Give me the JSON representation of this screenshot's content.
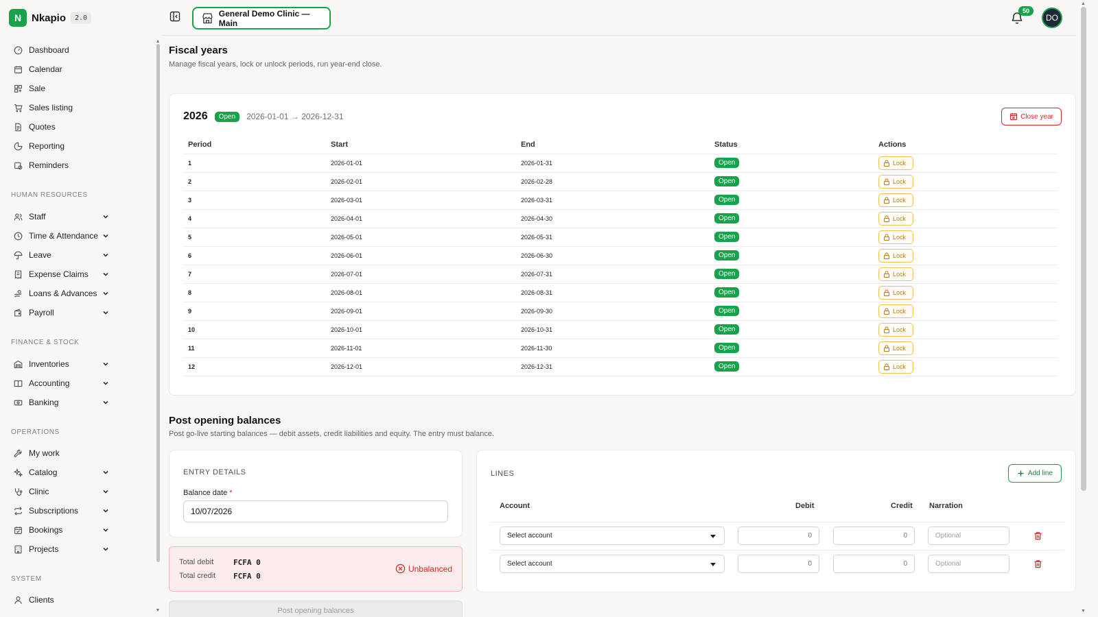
{
  "brand": {
    "initial": "N",
    "name": "Nkapio",
    "version": "2.0"
  },
  "nav": {
    "top": [
      "Dashboard",
      "Calendar",
      "Sale",
      "Sales listing",
      "Quotes",
      "Reporting",
      "Reminders"
    ],
    "hr_title": "HUMAN RESOURCES",
    "hr": [
      "Staff",
      "Time & Attendance",
      "Leave",
      "Expense Claims",
      "Loans & Advances",
      "Payroll"
    ],
    "fin_title": "FINANCE & STOCK",
    "fin": [
      "Inventories",
      "Accounting",
      "Banking"
    ],
    "ops_title": "OPERATIONS",
    "ops": [
      "My work",
      "Catalog",
      "Clinic",
      "Subscriptions",
      "Bookings",
      "Projects"
    ],
    "sys_title": "SYSTEM",
    "sys": [
      "Clients"
    ]
  },
  "topbar": {
    "clinic": "General Demo Clinic — Main",
    "notifications": "50",
    "avatar": "DO"
  },
  "fiscal": {
    "title": "Fiscal years",
    "subtitle": "Manage fiscal years, lock or unlock periods, run year-end close.",
    "year": "2026",
    "status": "Open",
    "range": "2026-01-01 → 2026-12-31",
    "close_btn": "Close year",
    "headers": [
      "Period",
      "Start",
      "End",
      "Status",
      "Actions"
    ],
    "lock_label": "Lock",
    "periods": [
      {
        "period": "1",
        "start": "2026-01-01",
        "end": "2026-01-31",
        "status": "Open"
      },
      {
        "period": "2",
        "start": "2026-02-01",
        "end": "2026-02-28",
        "status": "Open"
      },
      {
        "period": "3",
        "start": "2026-03-01",
        "end": "2026-03-31",
        "status": "Open"
      },
      {
        "period": "4",
        "start": "2026-04-01",
        "end": "2026-04-30",
        "status": "Open"
      },
      {
        "period": "5",
        "start": "2026-05-01",
        "end": "2026-05-31",
        "status": "Open"
      },
      {
        "period": "6",
        "start": "2026-06-01",
        "end": "2026-06-30",
        "status": "Open"
      },
      {
        "period": "7",
        "start": "2026-07-01",
        "end": "2026-07-31",
        "status": "Open"
      },
      {
        "period": "8",
        "start": "2026-08-01",
        "end": "2026-08-31",
        "status": "Open"
      },
      {
        "period": "9",
        "start": "2026-09-01",
        "end": "2026-09-30",
        "status": "Open"
      },
      {
        "period": "10",
        "start": "2026-10-01",
        "end": "2026-10-31",
        "status": "Open"
      },
      {
        "period": "11",
        "start": "2026-11-01",
        "end": "2026-11-30",
        "status": "Open"
      },
      {
        "period": "12",
        "start": "2026-12-01",
        "end": "2026-12-31",
        "status": "Open"
      }
    ]
  },
  "opening": {
    "title": "Post opening balances",
    "subtitle": "Post go-live starting balances — debit assets, credit liabilities and equity. The entry must balance.",
    "entry_title": "ENTRY DETAILS",
    "date_label": "Balance date",
    "date_required": "*",
    "date_value": "10/07/2026",
    "total_debit_label": "Total debit",
    "total_debit_value": "FCFA 0",
    "total_credit_label": "Total credit",
    "total_credit_value": "FCFA 0",
    "balance_status": "Unbalanced",
    "post_btn": "Post opening balances",
    "lines_title": "LINES",
    "add_line": "Add line",
    "col_account": "Account",
    "col_debit": "Debit",
    "col_credit": "Credit",
    "col_narration": "Narration",
    "lines": [
      {
        "account": "Select account",
        "debit": "0",
        "credit": "0",
        "narration_placeholder": "Optional"
      },
      {
        "account": "Select account",
        "debit": "0",
        "credit": "0",
        "narration_placeholder": "Optional"
      }
    ]
  },
  "colors": {
    "accent": "#16a34a",
    "danger": "#dc2626",
    "warning": "#f2c14e"
  }
}
